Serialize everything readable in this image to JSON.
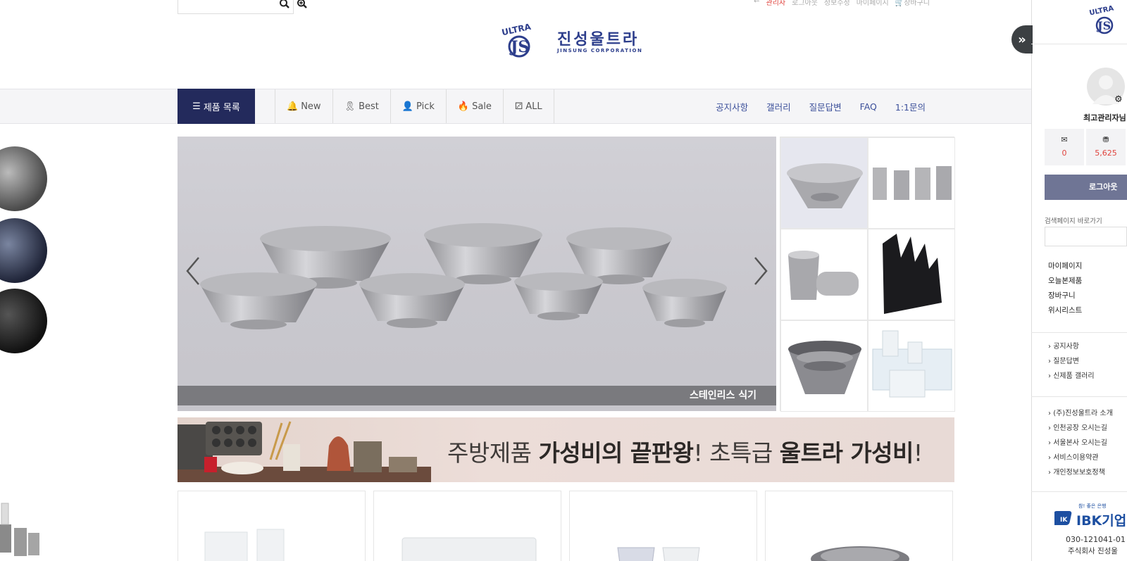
{
  "header": {
    "top_links": [
      "관리자",
      "로그아웃",
      "정보수정",
      "마이페이지",
      "장바구니"
    ],
    "logo_text": "진성울트라",
    "logo_sub": "JINSUNG CORPORATION",
    "logo_mark": "ULTRA"
  },
  "nav": {
    "category_button": "제품 목록",
    "tabs": [
      {
        "label": "New",
        "icon": "bell-icon"
      },
      {
        "label": "Best",
        "icon": "award-icon"
      },
      {
        "label": "Pick",
        "icon": "user-pick-icon"
      },
      {
        "label": "Sale",
        "icon": "fire-icon"
      },
      {
        "label": "ALL",
        "icon": "cubes-icon"
      }
    ],
    "right_links": [
      "공지사항",
      "갤러리",
      "질문답변",
      "FAQ",
      "1:1문의"
    ]
  },
  "slider": {
    "caption": "스테인리스 식기"
  },
  "banner": {
    "text_prefix": "주방제품 ",
    "text_bold1": "가성비의 끝판왕",
    "text_mid": "! 초특급 ",
    "text_bold2": "울트라 가성비",
    "text_suffix": "!"
  },
  "sidebar": {
    "logo_mark": "ULTRA",
    "username": "최고관리자님",
    "messages_count": "0",
    "points": "5,625",
    "logout_label": "로그아웃",
    "search_label": "검색페이지 바로가기",
    "menu": [
      "마이페이지",
      "오늘본제품",
      "장바구니",
      "위시리스트"
    ],
    "board_links": [
      "공지사항",
      "질문답변",
      "신제품 갤러리"
    ],
    "info_links": [
      "(주)진성울트라 소개",
      "인천공장 오시는길",
      "서울본사 오시는길",
      "서비스이용약관",
      "개인정보보호정책"
    ],
    "bank_tagline": "참! 좋은 은행",
    "bank_name": "IBK기업",
    "account_number": "030-121041-01",
    "account_holder": "주식회사 진성울"
  },
  "colors": {
    "nav_dark": "#232a5c",
    "link_blue": "#3b4f9a",
    "accent_red": "#e0443e",
    "logo_blue": "#2d3e8c"
  }
}
